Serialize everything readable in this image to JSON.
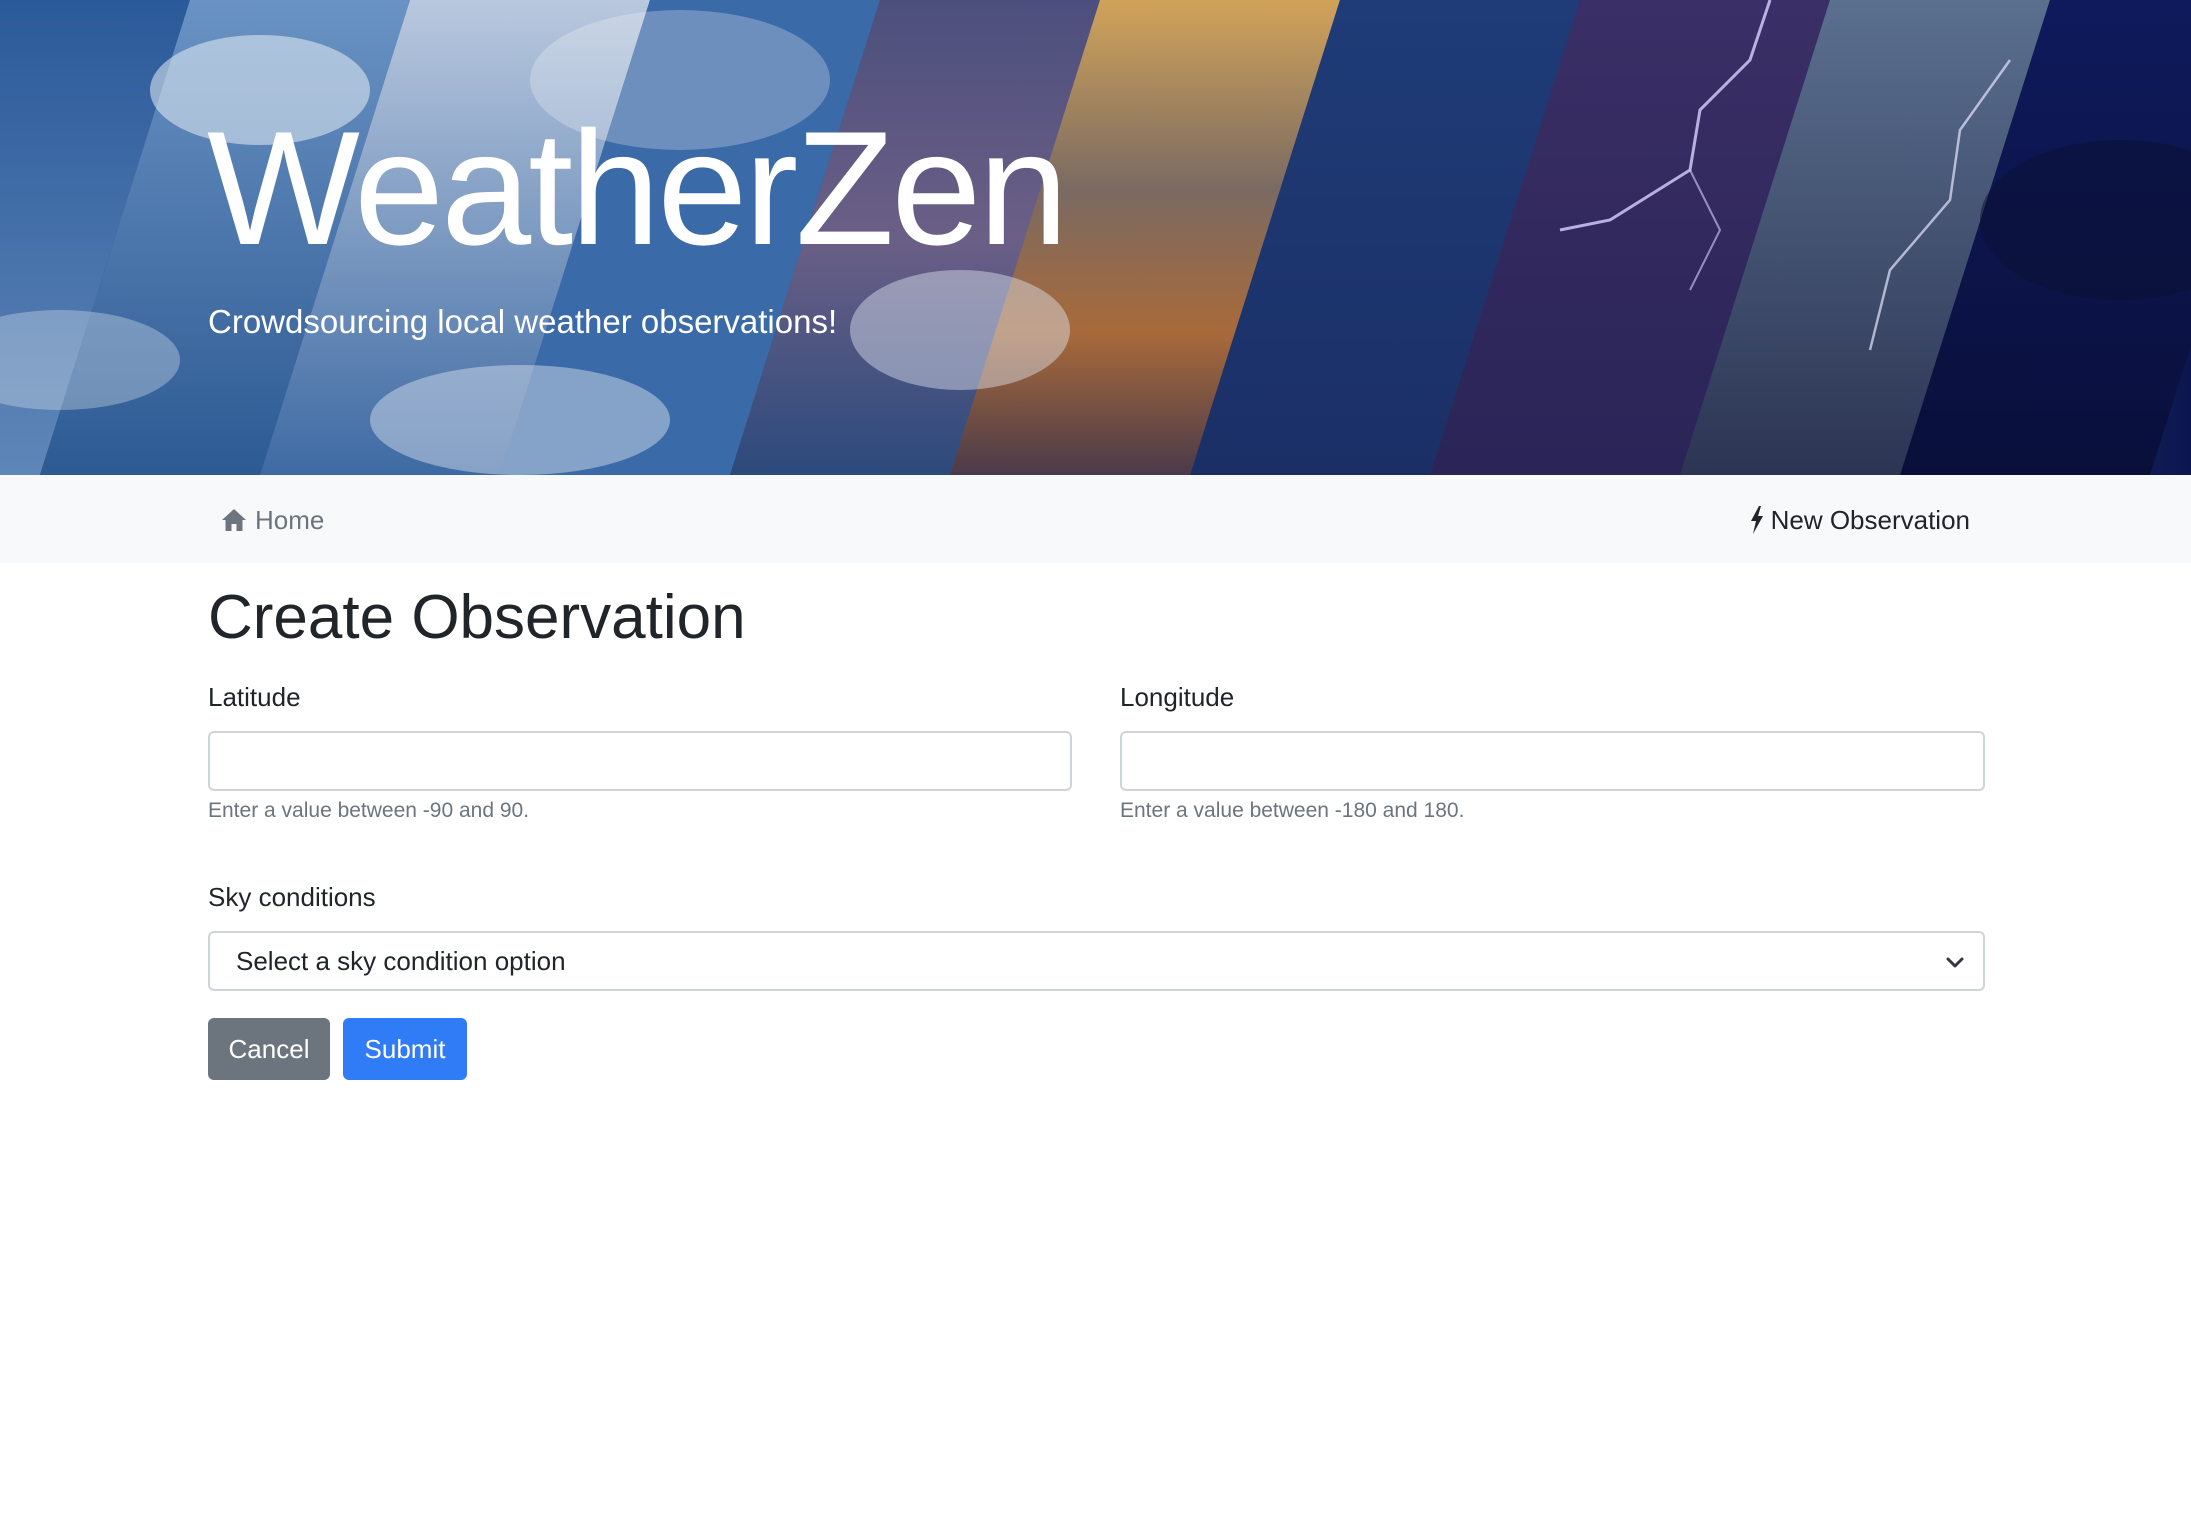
{
  "hero": {
    "title": "WeatherZen",
    "subtitle": "Crowdsourcing local weather observations!"
  },
  "nav": {
    "home_label": "Home",
    "home_icon": "home-icon",
    "new_label": "New Observation",
    "new_icon": "lightning-icon"
  },
  "form": {
    "title": "Create Observation",
    "latitude": {
      "label": "Latitude",
      "value": "",
      "help": "Enter a value between -90 and 90."
    },
    "longitude": {
      "label": "Longitude",
      "value": "",
      "help": "Enter a value between -180 and 180."
    },
    "sky": {
      "label": "Sky conditions",
      "selected": "Select a sky condition option"
    },
    "cancel_label": "Cancel",
    "submit_label": "Submit"
  },
  "colors": {
    "cancel": "#6c757d",
    "submit": "#2f7cf6",
    "navbar": "#f8f9fa"
  }
}
